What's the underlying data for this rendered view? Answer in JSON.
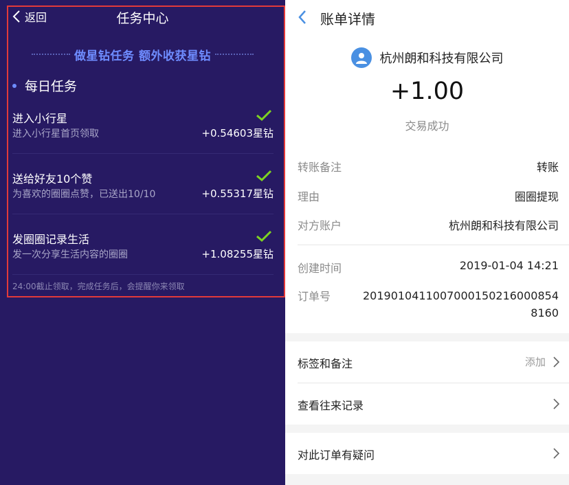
{
  "task_center": {
    "back_label": "返回",
    "title": "任务中心",
    "banner": "做星钻任务 额外收获星钻",
    "section_title": "每日任务",
    "tasks": [
      {
        "name": "进入小行星",
        "desc": "进入小行星首页领取",
        "reward": "+0.54603星钻",
        "check_icon": "check-icon"
      },
      {
        "name": "送给好友10个赞",
        "desc": "为喜欢的圈圈点赞，已送出10/10",
        "reward": "+0.55317星钻",
        "check_icon": "check-icon"
      },
      {
        "name": "发圈圈记录生活",
        "desc": "发一次分享生活内容的圈圈",
        "reward": "+1.08255星钻",
        "check_icon": "check-icon"
      }
    ],
    "footer": "24:00截止领取，完成任务后，会提醒你来领取",
    "colors": {
      "background": "#271a63",
      "accent": "#6e8cff",
      "check": "#7ed321",
      "highlight_frame": "#e33a3a"
    }
  },
  "bill_detail": {
    "title": "账单详情",
    "merchant": "杭州朗和科技有限公司",
    "amount": "+1.00",
    "status": "交易成功",
    "fields": [
      {
        "key": "转账备注",
        "value": "转账"
      },
      {
        "key": "理由",
        "value": "圈圈提现"
      },
      {
        "key": "对方账户",
        "value": "杭州朗和科技有限公司"
      },
      {
        "key": "创建时间",
        "value": "2019-01-04 14:21"
      },
      {
        "key": "订单号",
        "value": "2019010411007000150216000854 8160"
      }
    ],
    "rows": [
      {
        "label": "标签和备注",
        "hint": "添加"
      },
      {
        "label": "查看往来记录",
        "hint": ""
      },
      {
        "label": "对此订单有疑问",
        "hint": ""
      }
    ],
    "colors": {
      "accent": "#4a90e2"
    }
  }
}
